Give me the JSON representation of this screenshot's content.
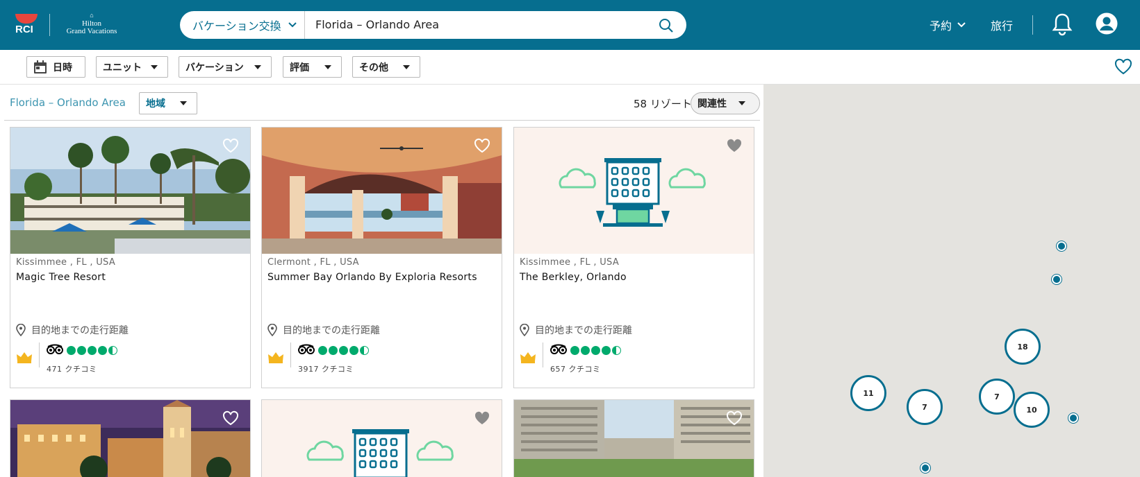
{
  "header": {
    "logo_rci": "RCI",
    "logo_hilton_small": "Hilton",
    "logo_hilton_line1": "Hilton",
    "logo_hilton_line2": "Grand Vacations",
    "search_type": "バケーション交換",
    "search_value": "Florida – Orlando Area",
    "nav_booking": "予約",
    "nav_travel": "旅行"
  },
  "filters": {
    "date": "日時",
    "unit": "ユニット",
    "vacation": "バケーション",
    "rating": "評価",
    "other": "その他"
  },
  "subbar": {
    "location": "Florida – Orlando Area",
    "region": "地域",
    "count": "58 リゾート",
    "sort": "関連性"
  },
  "cards": [
    {
      "location": "Kissimmee , FL , USA",
      "name": "Magic Tree Resort",
      "distance": "目的地までの走行距離",
      "reviews": "471 クチコミ",
      "rating": 4.5
    },
    {
      "location": "Clermont , FL , USA",
      "name": "Summer Bay Orlando By Exploria Resorts",
      "distance": "目的地までの走行距離",
      "reviews": "3917 クチコミ",
      "rating": 4.5
    },
    {
      "location": "Kissimmee , FL , USA",
      "name": "The Berkley, Orlando",
      "distance": "目的地までの走行距離",
      "reviews": "657 クチコミ",
      "rating": 4.5
    }
  ],
  "map": {
    "clusters": [
      "18",
      "11",
      "7",
      "7",
      "10"
    ]
  },
  "colors": {
    "brand": "#066e8f",
    "rating_green": "#00aa6c",
    "placeholder_bg": "#fbf2ed",
    "cloud": "#6fd6a1"
  }
}
